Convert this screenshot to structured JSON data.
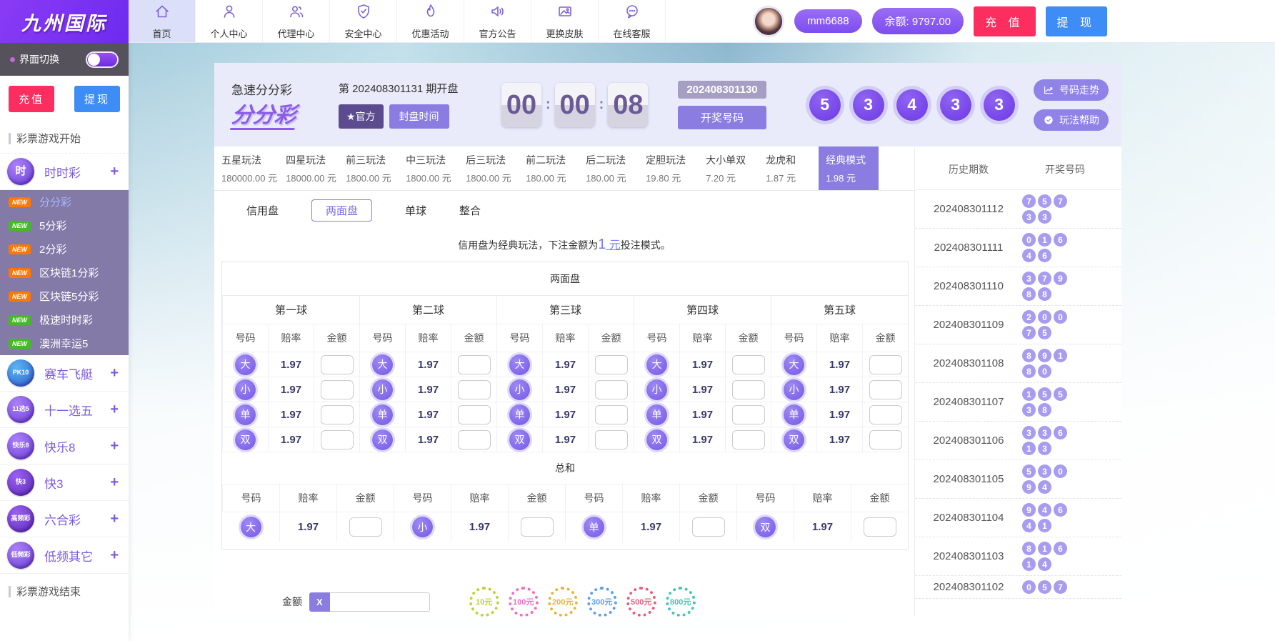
{
  "brand": {
    "logo_text": "九州国际"
  },
  "topnav": {
    "items": [
      {
        "label": "首页",
        "active": true
      },
      {
        "label": "个人中心"
      },
      {
        "label": "代理中心"
      },
      {
        "label": "安全中心"
      },
      {
        "label": "优惠活动"
      },
      {
        "label": "官方公告"
      },
      {
        "label": "更换皮肤"
      },
      {
        "label": "在线客服"
      }
    ]
  },
  "user": {
    "username": "mm6688",
    "balance": "余额: 9797.00",
    "recharge_label": "充 值",
    "withdraw_label": "提 现"
  },
  "sidebar": {
    "toggle_label": "界面切换",
    "recharge_label": "充值",
    "withdraw_label": "提现",
    "section_start": "彩票游戏开始",
    "section_end": "彩票游戏结束",
    "primary_group": {
      "icon_text": "时",
      "label": "时时彩",
      "expand": "+",
      "ball": "purple"
    },
    "submenu": [
      {
        "label": "分分彩",
        "badge": "NEW",
        "badge_color": "orange",
        "active": true
      },
      {
        "label": "5分彩",
        "badge": "NEW",
        "badge_color": "green"
      },
      {
        "label": "2分彩",
        "badge": "NEW",
        "badge_color": "orange"
      },
      {
        "label": "区块链1分彩",
        "badge": "NEW",
        "badge_color": "orange"
      },
      {
        "label": "区块链5分彩",
        "badge": "NEW",
        "badge_color": "orange"
      },
      {
        "label": "极速时时彩",
        "badge": "NEW",
        "badge_color": "green"
      },
      {
        "label": "澳洲幸运5",
        "badge": "NEW",
        "badge_color": "green"
      }
    ],
    "groups": [
      {
        "icon_text": "PK10",
        "label": "赛车飞艇",
        "expand": "+",
        "ball": "blue"
      },
      {
        "icon_text": "11选5",
        "label": "十一选五",
        "expand": "+",
        "ball": "purple"
      },
      {
        "icon_text": "快乐8",
        "label": "快乐8",
        "expand": "+",
        "ball": "purple"
      },
      {
        "icon_text": "快3",
        "label": "快3",
        "expand": "+",
        "ball": "deep"
      },
      {
        "icon_text": "高频彩",
        "label": "六合彩",
        "expand": "+",
        "ball": "deep"
      },
      {
        "icon_text": "低频彩",
        "label": "低频其它",
        "expand": "+",
        "ball": "purple"
      }
    ]
  },
  "game": {
    "name": "急速分分彩",
    "logo_text": "分分彩",
    "period_label": "第 202408301131 期开盘",
    "official_label": "★官方",
    "close_time_label": "封盘时间",
    "countdown": [
      "00",
      "00",
      "08"
    ],
    "last_period": "202408301130",
    "draw_label": "开奖号码",
    "result_balls": [
      "5",
      "3",
      "4",
      "3",
      "3"
    ],
    "trend_label": "号码走势",
    "help_label": "玩法帮助"
  },
  "play_tabs": [
    {
      "name": "五星玩法",
      "amount": "180000.00 元"
    },
    {
      "name": "四星玩法",
      "amount": "18000.00 元"
    },
    {
      "name": "前三玩法",
      "amount": "1800.00 元"
    },
    {
      "name": "中三玩法",
      "amount": "1800.00 元"
    },
    {
      "name": "后三玩法",
      "amount": "1800.00 元"
    },
    {
      "name": "前二玩法",
      "amount": "180.00 元"
    },
    {
      "name": "后二玩法",
      "amount": "180.00 元"
    },
    {
      "name": "定胆玩法",
      "amount": "19.80 元"
    },
    {
      "name": "大小单双",
      "amount": "7.20 元"
    },
    {
      "name": "龙虎和",
      "amount": "1.87 元"
    },
    {
      "name": "经典模式",
      "amount": "1.98 元",
      "active": true
    }
  ],
  "sub_tabs": {
    "items": [
      {
        "label": "信用盘"
      },
      {
        "label": "两面盘",
        "active": true
      },
      {
        "label": "单球"
      },
      {
        "label": "整合"
      }
    ]
  },
  "notice": {
    "prefix": "信用盘为经典玩法，下注金额为",
    "highlight_num": "1",
    "highlight_unit": " 元",
    "suffix": "投注模式。"
  },
  "bet_table": {
    "panel_title": "两面盘",
    "groups": [
      {
        "name": "第一球"
      },
      {
        "name": "第二球"
      },
      {
        "name": "第三球"
      },
      {
        "name": "第四球"
      },
      {
        "name": "第五球"
      }
    ],
    "col_headers": [
      "号码",
      "赔率",
      "金额"
    ],
    "rows": [
      {
        "label": "大"
      },
      {
        "label": "小"
      },
      {
        "label": "单"
      },
      {
        "label": "双"
      }
    ],
    "odds": "1.97",
    "sum_title": "总和",
    "sum_cells": [
      {
        "label": "大"
      },
      {
        "label": "小"
      },
      {
        "label": "单"
      },
      {
        "label": "双"
      }
    ],
    "sum_odds": "1.97"
  },
  "amount_bar": {
    "label": "金额",
    "multiplier": "X",
    "input_value": "",
    "chips": [
      {
        "label": "10元",
        "color": "#b9d437"
      },
      {
        "label": "100元",
        "color": "#ef6fc0"
      },
      {
        "label": "200元",
        "color": "#e9b33e"
      },
      {
        "label": "300元",
        "color": "#5f9fe8"
      },
      {
        "label": "500元",
        "color": "#e85f7e"
      },
      {
        "label": "800元",
        "color": "#45c4b4"
      }
    ]
  },
  "history": {
    "headers": [
      "历史期数",
      "开奖号码"
    ],
    "rows": [
      {
        "period": "202408301112",
        "balls": [
          "7",
          "5",
          "7",
          "3",
          "3"
        ]
      },
      {
        "period": "202408301111",
        "balls": [
          "0",
          "1",
          "6",
          "4",
          "6"
        ]
      },
      {
        "period": "202408301110",
        "balls": [
          "3",
          "7",
          "9",
          "8",
          "8"
        ]
      },
      {
        "period": "202408301109",
        "balls": [
          "2",
          "0",
          "0",
          "7",
          "5"
        ]
      },
      {
        "period": "202408301108",
        "balls": [
          "8",
          "9",
          "1",
          "8",
          "0"
        ]
      },
      {
        "period": "202408301107",
        "balls": [
          "1",
          "5",
          "5",
          "3",
          "8"
        ]
      },
      {
        "period": "202408301106",
        "balls": [
          "3",
          "3",
          "6",
          "1",
          "3"
        ]
      },
      {
        "period": "202408301105",
        "balls": [
          "5",
          "3",
          "0",
          "9",
          "4"
        ]
      },
      {
        "period": "202408301104",
        "balls": [
          "9",
          "4",
          "6",
          "4",
          "1"
        ]
      },
      {
        "period": "202408301103",
        "balls": [
          "8",
          "1",
          "6",
          "1",
          "4"
        ]
      },
      {
        "period": "202408301102",
        "balls": [
          "0",
          "5",
          "7"
        ]
      }
    ]
  }
}
